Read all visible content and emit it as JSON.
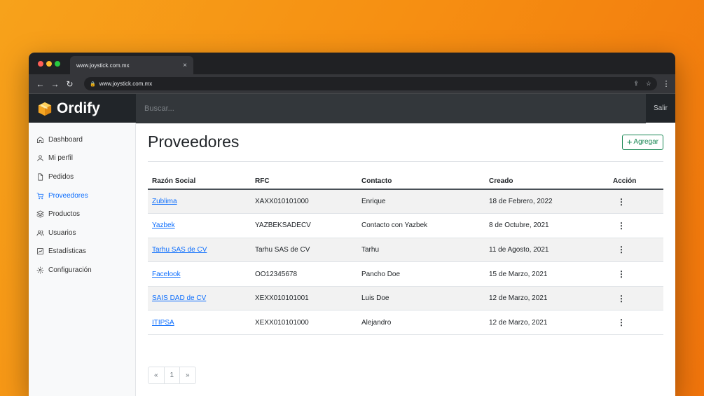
{
  "browser": {
    "tab_title": "www.joystick.com.mx",
    "tab_close": "×",
    "url": "www.joystick.com.mx"
  },
  "app": {
    "brand": "Ordify",
    "search_placeholder": "Buscar...",
    "signout_label": "Salir"
  },
  "sidebar": {
    "items": [
      {
        "label": "Dashboard",
        "icon": "home-icon"
      },
      {
        "label": "Mi perfil",
        "icon": "user-icon"
      },
      {
        "label": "Pedidos",
        "icon": "file-icon"
      },
      {
        "label": "Proveedores",
        "icon": "cart-icon",
        "active": true
      },
      {
        "label": "Productos",
        "icon": "layers-icon"
      },
      {
        "label": "Usuarios",
        "icon": "users-icon"
      },
      {
        "label": "Estadísticas",
        "icon": "chart-icon"
      },
      {
        "label": "Configuración",
        "icon": "gear-icon"
      }
    ]
  },
  "main": {
    "title": "Proveedores",
    "add_label": "Agregar",
    "add_plus": "+",
    "columns": [
      "Razón Social",
      "RFC",
      "Contacto",
      "Creado",
      "Acción"
    ],
    "rows": [
      {
        "name": "Zublima",
        "rfc": "XAXX010101000",
        "contact": "Enrique",
        "created": "18 de Febrero, 2022"
      },
      {
        "name": "Yazbek",
        "rfc": "YAZBEKSADECV",
        "contact": "Contacto con Yazbek",
        "created": "8 de Octubre, 2021"
      },
      {
        "name": "Tarhu SAS de CV",
        "rfc": "Tarhu SAS de CV",
        "contact": "Tarhu",
        "created": "11 de Agosto, 2021"
      },
      {
        "name": "Facelook",
        "rfc": "OO12345678",
        "contact": "Pancho Doe",
        "created": "15 de Marzo, 2021"
      },
      {
        "name": "SAIS DAD de CV",
        "rfc": "XEXX010101001",
        "contact": "Luis Doe",
        "created": "12 de Marzo, 2021"
      },
      {
        "name": "ITIPSA",
        "rfc": "XEXX010101000",
        "contact": "Alejandro",
        "created": "12 de Marzo, 2021"
      }
    ],
    "action_glyph": "⋮",
    "pagination": {
      "prev": "«",
      "page": "1",
      "next": "»"
    }
  }
}
